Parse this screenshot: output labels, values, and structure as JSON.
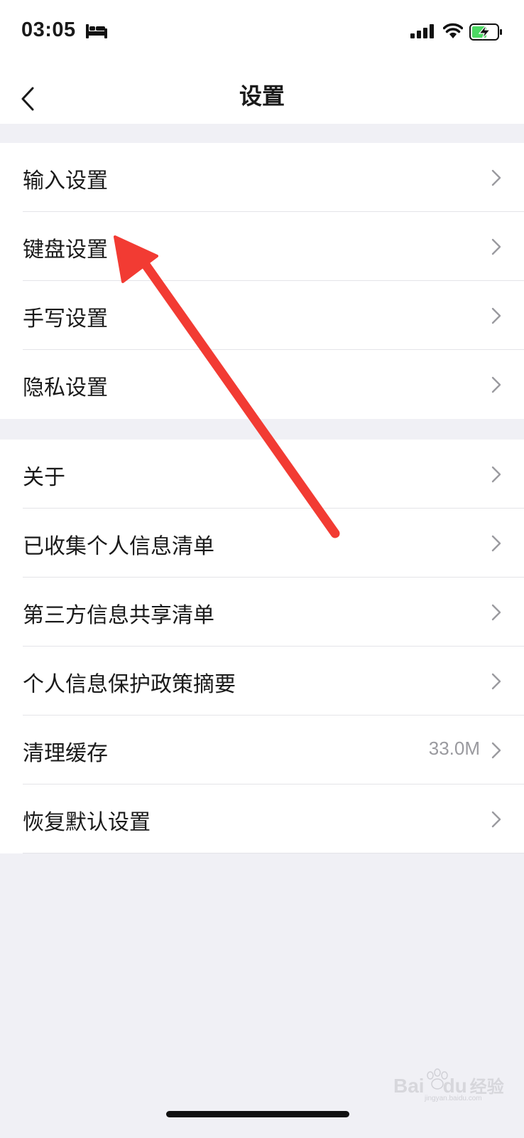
{
  "status_bar": {
    "time": "03:05"
  },
  "nav": {
    "title": "设置"
  },
  "group1": [
    {
      "label": "输入设置"
    },
    {
      "label": "键盘设置"
    },
    {
      "label": "手写设置"
    },
    {
      "label": "隐私设置"
    }
  ],
  "group2": [
    {
      "label": "关于"
    },
    {
      "label": "已收集个人信息清单"
    },
    {
      "label": "第三方信息共享清单"
    },
    {
      "label": "个人信息保护政策摘要"
    },
    {
      "label": "清理缓存",
      "value": "33.0M"
    },
    {
      "label": "恢复默认设置"
    }
  ],
  "watermark": {
    "brand": "Bai",
    "brand2": "du",
    "suffix": "经验",
    "url": "jingyan.baidu.com"
  },
  "colors": {
    "annotation_arrow": "#f23b33",
    "battery_charge": "#4cd964",
    "page_background": "#f0f0f5"
  }
}
